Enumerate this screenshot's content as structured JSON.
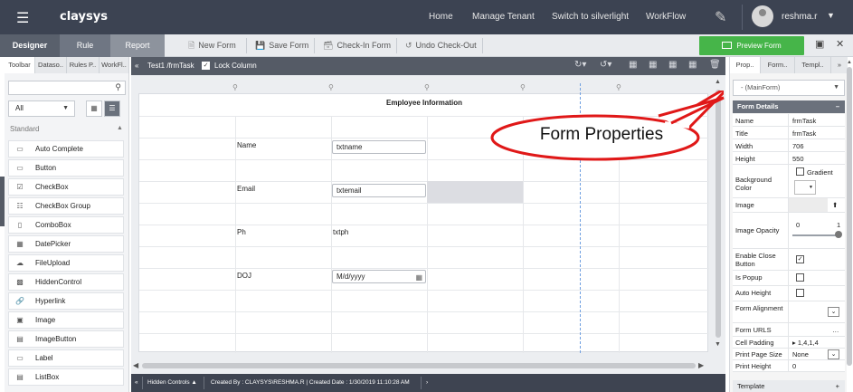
{
  "topbar": {
    "logo": "claysys",
    "nav": [
      "Home",
      "Manage Tenant",
      "Switch to silverlight",
      "WorkFlow"
    ],
    "user": "reshma.r"
  },
  "tabs": {
    "designer": "Designer",
    "rule": "Rule",
    "report": "Report"
  },
  "toolbar": {
    "new_form": "New Form",
    "save_form": "Save Form",
    "check_in": "Check-In Form",
    "undo_checkout": "Undo Check-Out",
    "preview": "Preview Form"
  },
  "left_panel": {
    "tabs": [
      "Toolbar",
      "Dataso..",
      "Rules P..",
      "WorkFl.."
    ],
    "filter": "All",
    "section": "Standard",
    "controls": [
      {
        "label": "Auto Complete",
        "icon": "auto-complete-icon"
      },
      {
        "label": "Button",
        "icon": "button-icon"
      },
      {
        "label": "CheckBox",
        "icon": "checkbox-icon"
      },
      {
        "label": "CheckBox Group",
        "icon": "checkbox-group-icon"
      },
      {
        "label": "ComboBox",
        "icon": "combobox-icon"
      },
      {
        "label": "DatePicker",
        "icon": "datepicker-icon"
      },
      {
        "label": "FileUpload",
        "icon": "fileupload-icon"
      },
      {
        "label": "HiddenControl",
        "icon": "hidden-control-icon"
      },
      {
        "label": "Hyperlink",
        "icon": "hyperlink-icon"
      },
      {
        "label": "Image",
        "icon": "image-icon"
      },
      {
        "label": "ImageButton",
        "icon": "image-button-icon"
      },
      {
        "label": "Label",
        "icon": "label-icon"
      },
      {
        "label": "ListBox",
        "icon": "listbox-icon"
      }
    ]
  },
  "canvas": {
    "breadcrumb": "Test1 /frmTask",
    "lock_column": "Lock Column",
    "form_title": "Employee Information",
    "fields": [
      {
        "label": "Name",
        "value": "txtname"
      },
      {
        "label": "Email",
        "value": "txtemail"
      },
      {
        "label": "Ph",
        "value": "txtph"
      },
      {
        "label": "DOJ",
        "value": "M/d/yyyy"
      }
    ]
  },
  "status": {
    "hidden_controls": "Hidden Controls",
    "created": "Created By : CLAYSYS\\RESHMA.R | Created Date : 1/30/2019 11:10:28 AM"
  },
  "right_panel": {
    "tabs": [
      "Prop..",
      "Form..",
      "Templ.."
    ],
    "selected": "- (MainForm)",
    "section": "Form Details",
    "props": {
      "name_key": "Name",
      "name_val": "frmTask",
      "title_key": "Title",
      "title_val": "frmTask",
      "width_key": "Width",
      "width_val": "706",
      "height_key": "Height",
      "height_val": "550",
      "bg_key": "Background Color",
      "gradient": "Gradient",
      "image_key": "Image",
      "opacity_key": "Image Opacity",
      "opacity_min": "0",
      "opacity_max": "1",
      "close_key": "Enable Close Button",
      "popup_key": "Is Popup",
      "autoheight_key": "Auto Height",
      "align_key": "Form Alignment",
      "urls_key": "Form URLS",
      "padding_key": "Cell Padding",
      "padding_val": "1,4,1,4",
      "pagesize_key": "Print Page Size",
      "pagesize_val": "None",
      "printheight_key": "Print Height",
      "printheight_val": "0"
    },
    "template": "Template"
  },
  "callout": "Form Properties",
  "colors": {
    "topbar": "#3c4352",
    "preview": "#46b549",
    "callout_border": "#e01818"
  }
}
